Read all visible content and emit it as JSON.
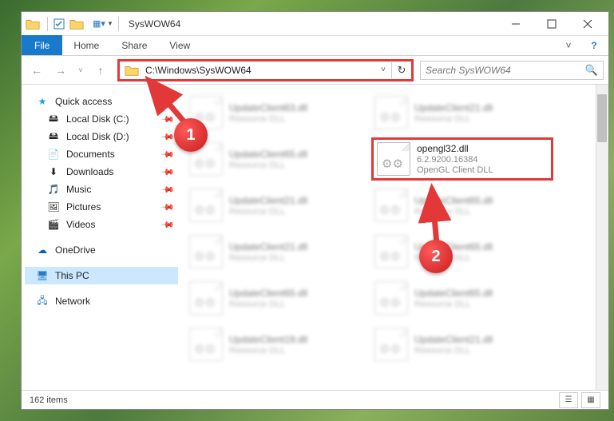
{
  "title": "SysWOW64",
  "tabs": {
    "file": "File",
    "home": "Home",
    "share": "Share",
    "view": "View"
  },
  "address": "C:\\Windows\\SysWOW64",
  "search_placeholder": "Search SysWOW64",
  "sidebar": {
    "quick_access": "Quick access",
    "items": [
      {
        "label": "Local Disk (C:)",
        "icon": "drive"
      },
      {
        "label": "Local Disk (D:)",
        "icon": "drive"
      },
      {
        "label": "Documents",
        "icon": "doc"
      },
      {
        "label": "Downloads",
        "icon": "down"
      },
      {
        "label": "Music",
        "icon": "music"
      },
      {
        "label": "Pictures",
        "icon": "pic"
      },
      {
        "label": "Videos",
        "icon": "vid"
      }
    ],
    "onedrive": "OneDrive",
    "thispc": "This PC",
    "network": "Network"
  },
  "files": [
    {
      "name": "UpdateClient63.dll",
      "sub1": "Resource DLL",
      "sub2": "",
      "blur": true
    },
    {
      "name": "UpdateClient21.dll",
      "sub1": "Resource DLL",
      "sub2": "",
      "blur": true
    },
    {
      "name": "UpdateClient65.dll",
      "sub1": "Resource DLL",
      "sub2": "",
      "blur": true
    },
    {
      "name": "opengl32.dll",
      "sub1": "6.2.9200.16384",
      "sub2": "OpenGL Client DLL",
      "highlight": true
    },
    {
      "name": "UpdateClient21.dll",
      "sub1": "Resource DLL",
      "sub2": "",
      "blur": true
    },
    {
      "name": "UpdateClient65.dll",
      "sub1": "Resource DLL",
      "sub2": "",
      "blur": true
    },
    {
      "name": "UpdateClient21.dll",
      "sub1": "Resource DLL",
      "sub2": "",
      "blur": true
    },
    {
      "name": "UpdateClient65.dll",
      "sub1": "Resource DLL",
      "sub2": "",
      "blur": true
    },
    {
      "name": "UpdateClient65.dll",
      "sub1": "Resource DLL",
      "sub2": "",
      "blur": true
    },
    {
      "name": "UpdateClient65.dll",
      "sub1": "Resource DLL",
      "sub2": "",
      "blur": true
    },
    {
      "name": "UpdateClient19.dll",
      "sub1": "Resource DLL",
      "sub2": "",
      "blur": true
    },
    {
      "name": "UpdateClient21.dll",
      "sub1": "Resource DLL",
      "sub2": "",
      "blur": true
    }
  ],
  "status": "162 items",
  "callouts": {
    "one": "1",
    "two": "2"
  }
}
